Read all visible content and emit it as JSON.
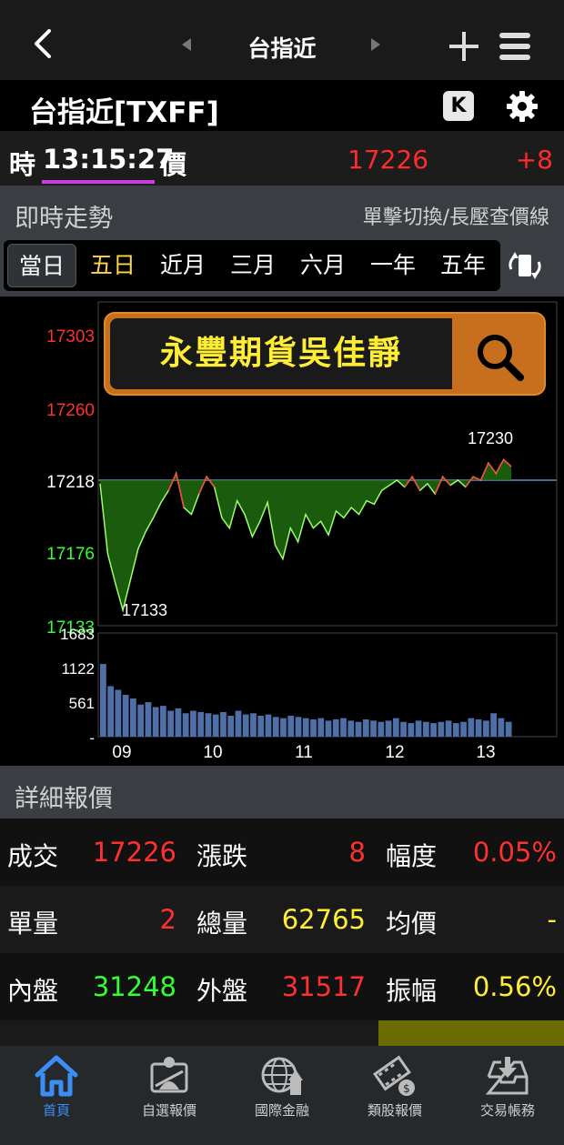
{
  "nav": {
    "title": "台指近"
  },
  "symbol": {
    "name": "台指近[TXFF]",
    "k_label": "K"
  },
  "quote_row": {
    "time_label": "時",
    "time": "13:15:27",
    "price_label": "價",
    "price": "17226",
    "change": "+8"
  },
  "trend_section": {
    "title": "即時走勢",
    "hint": "單擊切換/長壓查價線"
  },
  "periods": [
    {
      "label": "當日",
      "active": true
    },
    {
      "label": "五日",
      "active": false
    },
    {
      "label": "近月",
      "active": false
    },
    {
      "label": "三月",
      "active": false
    },
    {
      "label": "六月",
      "active": false
    },
    {
      "label": "一年",
      "active": false
    },
    {
      "label": "五年",
      "active": false
    }
  ],
  "banner": {
    "text": "永豐期貨吳佳靜"
  },
  "chart_data": {
    "type": "area",
    "price_ticks": [
      "17303",
      "17260",
      "17218",
      "17176",
      "17133"
    ],
    "reference_price": 17218,
    "high_label": "17230",
    "low_label": "17133",
    "volume_ticks": [
      "1683",
      "1122",
      "561",
      "-"
    ],
    "x_ticks": [
      "09",
      "10",
      "11",
      "12",
      "13"
    ],
    "series": [
      {
        "x": [
          "08:45",
          "08:50",
          "08:55",
          "09:00",
          "09:05",
          "09:10",
          "09:15",
          "09:20",
          "09:25",
          "09:30",
          "09:35",
          "09:40",
          "09:45",
          "09:50",
          "09:55",
          "10:00",
          "10:05",
          "10:10",
          "10:15",
          "10:20",
          "10:25",
          "10:30",
          "10:35",
          "10:40",
          "10:45",
          "10:50",
          "10:55",
          "11:00",
          "11:05",
          "11:10",
          "11:15",
          "11:20",
          "11:25",
          "11:30",
          "11:35",
          "11:40",
          "11:45",
          "11:50",
          "11:55",
          "12:00",
          "12:05",
          "12:10",
          "12:15",
          "12:20",
          "12:25",
          "12:30",
          "12:35",
          "12:40",
          "12:45",
          "12:50",
          "12:55",
          "13:00",
          "13:05",
          "13:10",
          "13:15"
        ],
        "y": [
          17216,
          17175,
          17158,
          17142,
          17160,
          17178,
          17188,
          17196,
          17205,
          17212,
          17222,
          17202,
          17198,
          17210,
          17220,
          17214,
          17196,
          17190,
          17206,
          17198,
          17185,
          17194,
          17205,
          17180,
          17172,
          17190,
          17182,
          17198,
          17190,
          17194,
          17186,
          17200,
          17196,
          17202,
          17198,
          17206,
          17204,
          17212,
          17215,
          17218,
          17214,
          17220,
          17212,
          17216,
          17210,
          17220,
          17215,
          17218,
          17214,
          17220,
          17218,
          17228,
          17222,
          17230,
          17226
        ]
      }
    ],
    "volume": [
      1180,
      820,
      760,
      680,
      620,
      520,
      560,
      480,
      500,
      420,
      460,
      380,
      420,
      400,
      380,
      360,
      400,
      340,
      420,
      360,
      380,
      340,
      360,
      320,
      300,
      340,
      320,
      300,
      280,
      300,
      260,
      280,
      300,
      260,
      240,
      280,
      260,
      240,
      260,
      300,
      240,
      220,
      260,
      240,
      220,
      240,
      260,
      220,
      240,
      300,
      280,
      260,
      380,
      300,
      240
    ]
  },
  "detail_section": {
    "title": "詳細報價"
  },
  "details": [
    [
      {
        "label": "成交",
        "value": "17226",
        "color": "#ff3030"
      },
      {
        "label": "漲跌",
        "value": "8",
        "color": "#ff3030"
      },
      {
        "label": "幅度",
        "value": "0.05%",
        "color": "#ff3030"
      }
    ],
    [
      {
        "label": "單量",
        "value": "2",
        "color": "#ff3030"
      },
      {
        "label": "總量",
        "value": "62765",
        "color": "#ffee33"
      },
      {
        "label": "均價",
        "value": "-",
        "color": "#ffee33"
      }
    ],
    [
      {
        "label": "內盤",
        "value": "31248",
        "color": "#33ff33"
      },
      {
        "label": "外盤",
        "value": "31517",
        "color": "#ff3030"
      },
      {
        "label": "振幅",
        "value": "0.56%",
        "color": "#ffee33"
      }
    ]
  ],
  "bottom_tabs": [
    {
      "label": "首頁",
      "icon": "home-icon",
      "active": true
    },
    {
      "label": "自選報價",
      "icon": "watchlist-icon",
      "active": false
    },
    {
      "label": "國際金融",
      "icon": "globe-icon",
      "active": false
    },
    {
      "label": "類股報價",
      "icon": "film-coin-icon",
      "active": false
    },
    {
      "label": "交易帳務",
      "icon": "inbox-download-icon",
      "active": false
    }
  ]
}
